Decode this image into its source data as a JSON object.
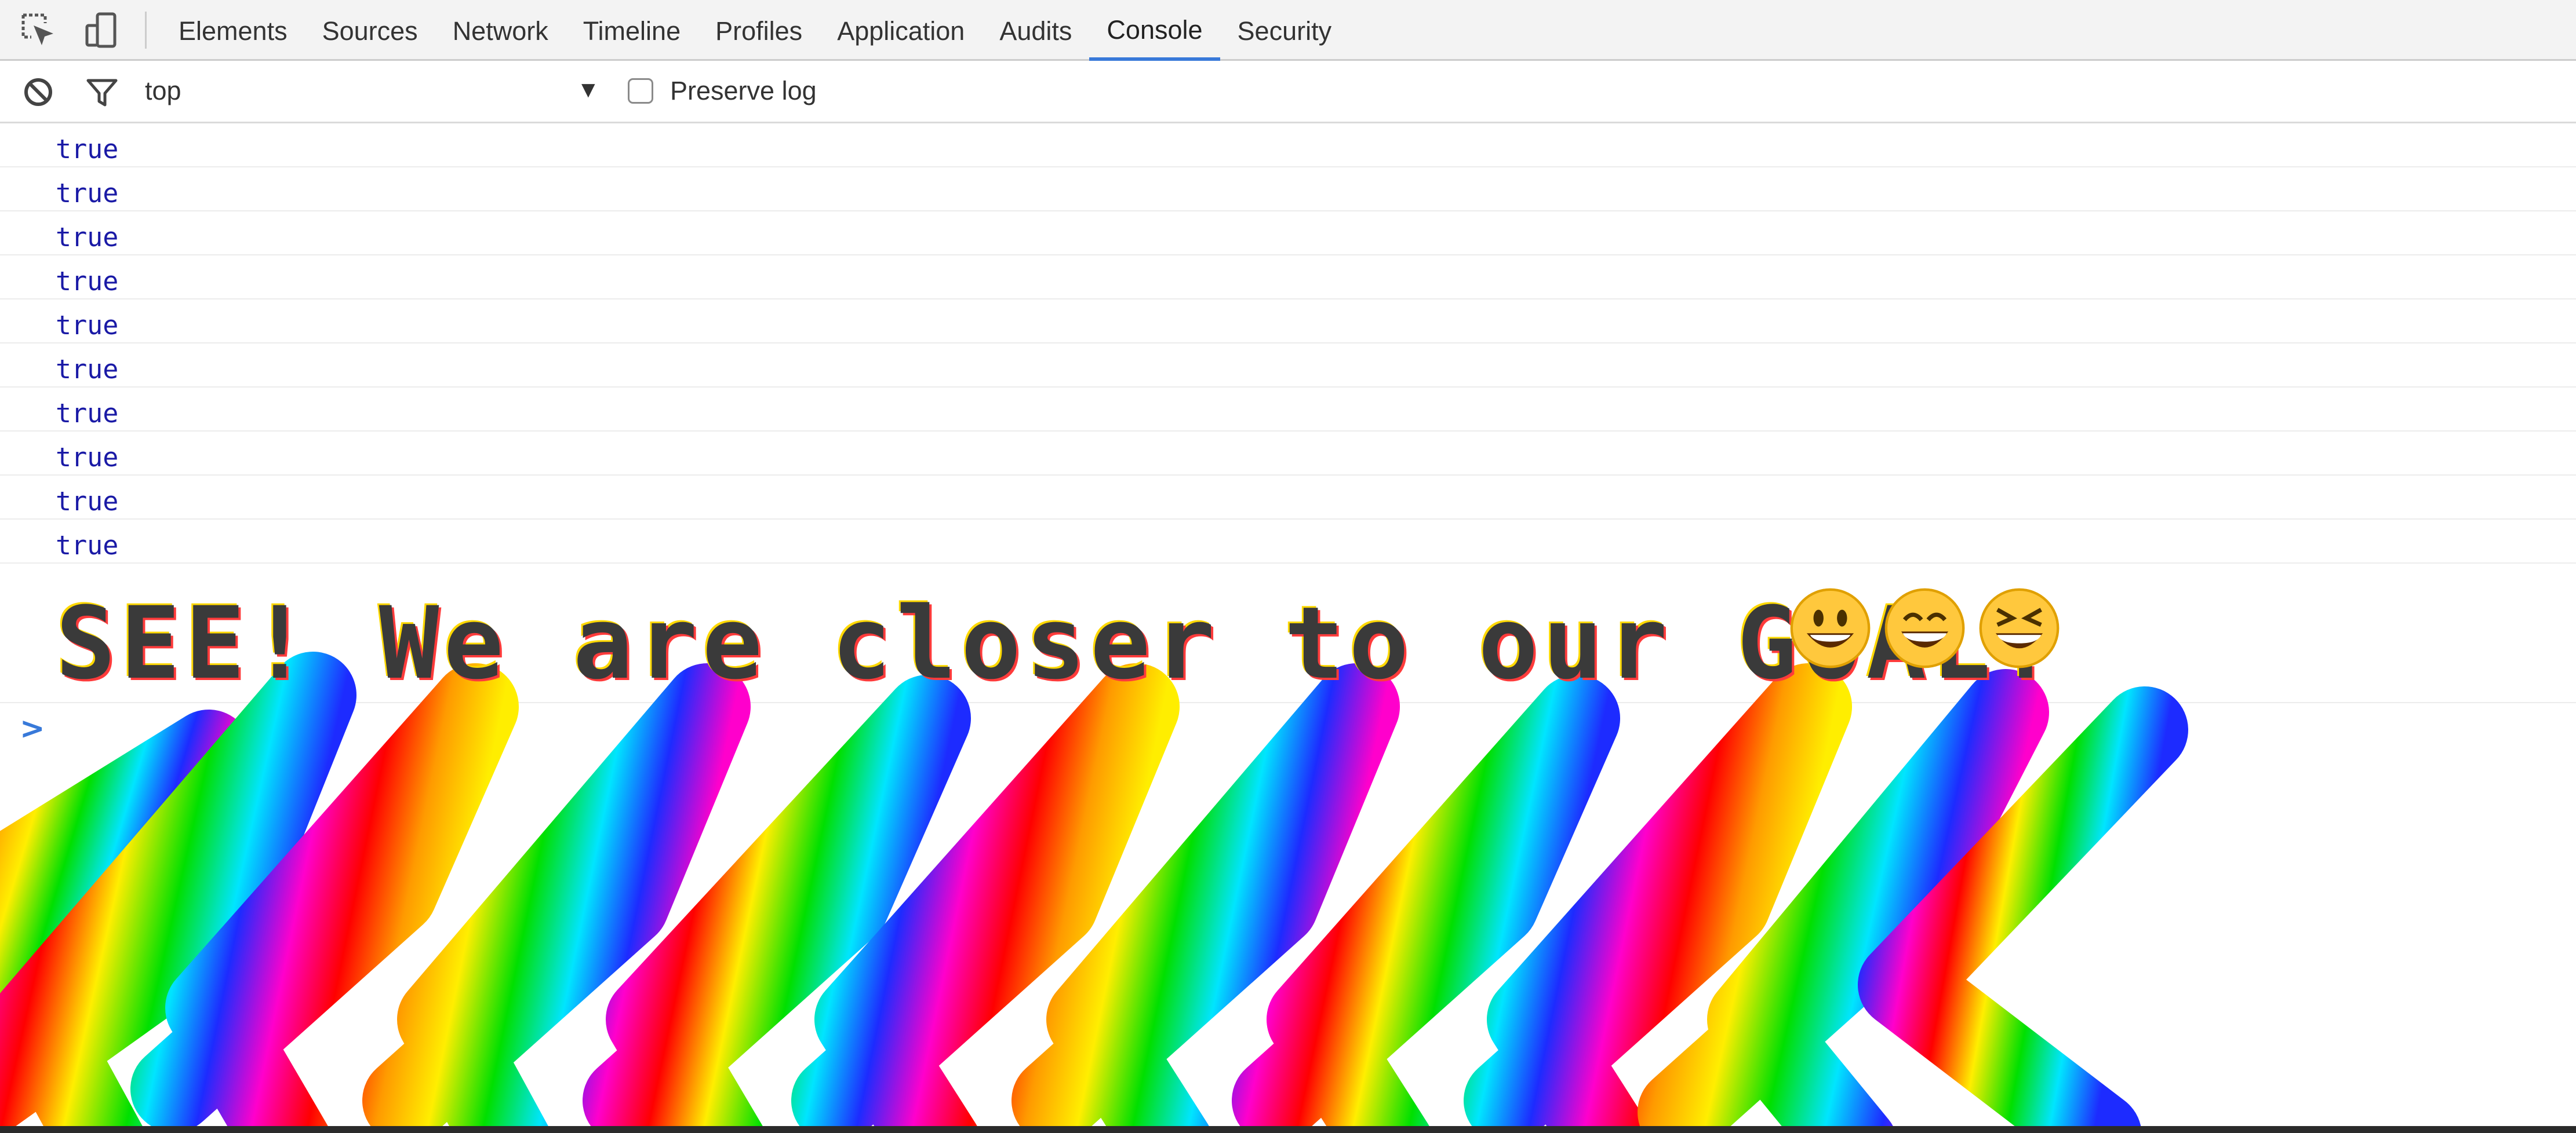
{
  "tabs": [
    {
      "label": "Elements"
    },
    {
      "label": "Sources"
    },
    {
      "label": "Network"
    },
    {
      "label": "Timeline"
    },
    {
      "label": "Profiles"
    },
    {
      "label": "Application"
    },
    {
      "label": "Audits"
    },
    {
      "label": "Console"
    },
    {
      "label": "Security"
    }
  ],
  "active_tab": "Console",
  "toolbar": {
    "context": "top",
    "preserve_log_label": "Preserve log",
    "preserve_log_checked": false
  },
  "messages": [
    "true",
    "true",
    "true",
    "true",
    "true",
    "true",
    "true",
    "true",
    "true",
    "true"
  ],
  "goal_message": "SEE! We are closer to our GOAL!",
  "goal_emojis": [
    "grinning-face-icon",
    "grinning-face-smiling-eyes-icon",
    "squinting-face-icon"
  ],
  "prompt_symbol": ">",
  "colors": {
    "accent": "#3879d9",
    "console_value": "#1a1aa6",
    "goal_text": "#3a3a3a"
  }
}
